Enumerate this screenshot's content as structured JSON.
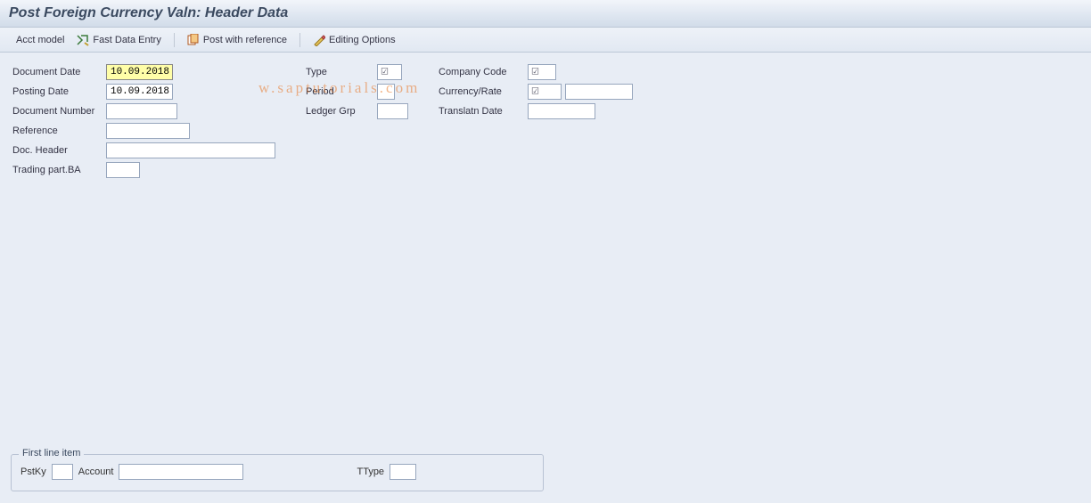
{
  "title": "Post Foreign Currency Valn: Header Data",
  "toolbar": {
    "acct_model": "Acct model",
    "fast_data_entry": "Fast Data Entry",
    "post_with_reference": "Post with reference",
    "editing_options": "Editing Options"
  },
  "form": {
    "col1": {
      "document_date": {
        "label": "Document Date",
        "value": "10.09.2018"
      },
      "posting_date": {
        "label": "Posting Date",
        "value": "10.09.2018"
      },
      "document_number": {
        "label": "Document Number",
        "value": ""
      },
      "reference": {
        "label": "Reference",
        "value": ""
      },
      "doc_header": {
        "label": "Doc. Header",
        "value": ""
      },
      "trading_part_ba": {
        "label": "Trading part.BA",
        "value": ""
      }
    },
    "col2": {
      "type": {
        "label": "Type",
        "value": "",
        "required": true
      },
      "period": {
        "label": "Period",
        "value": ""
      },
      "ledger_grp": {
        "label": "Ledger Grp",
        "value": ""
      }
    },
    "col3": {
      "company_code": {
        "label": "Company Code",
        "value": "",
        "required": true
      },
      "currency_rate": {
        "label": "Currency/Rate",
        "value": "",
        "rate_value": "",
        "required": true
      },
      "translatn_date": {
        "label": "Translatn Date",
        "value": ""
      }
    }
  },
  "line_item": {
    "legend": "First line item",
    "pstky": {
      "label": "PstKy",
      "value": ""
    },
    "account": {
      "label": "Account",
      "value": ""
    },
    "ttype": {
      "label": "TType",
      "value": ""
    }
  },
  "watermark": "w.saptutorials.com",
  "required_marker": "☑"
}
